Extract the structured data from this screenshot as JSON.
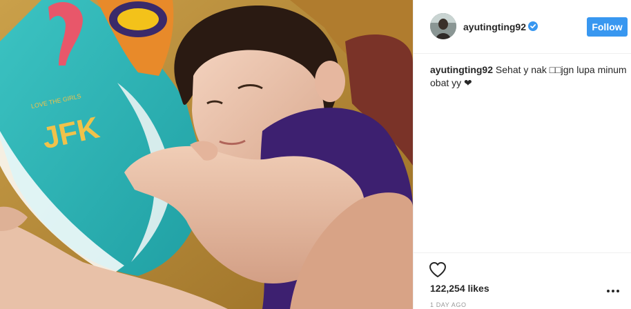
{
  "photo": {
    "pillow_text": "JFK",
    "pillow_small_text": "LOVE THE GIRLS",
    "pillow_color": "#2bb5b6",
    "blanket_color": "#c3913a",
    "shirt_color": "#3d2070"
  },
  "header": {
    "username": "ayutingting92",
    "verified": true,
    "follow_label": "Follow",
    "follow_color": "#3897f0"
  },
  "caption": {
    "username": "ayutingting92",
    "text": " Sehat y nak □□jgn lupa minum obat yy ❤"
  },
  "actions": {
    "likes": "122,254 likes",
    "timestamp": "1 DAY AGO",
    "heart_icon": "heart-outline-icon",
    "more_icon": "more-options-icon"
  }
}
